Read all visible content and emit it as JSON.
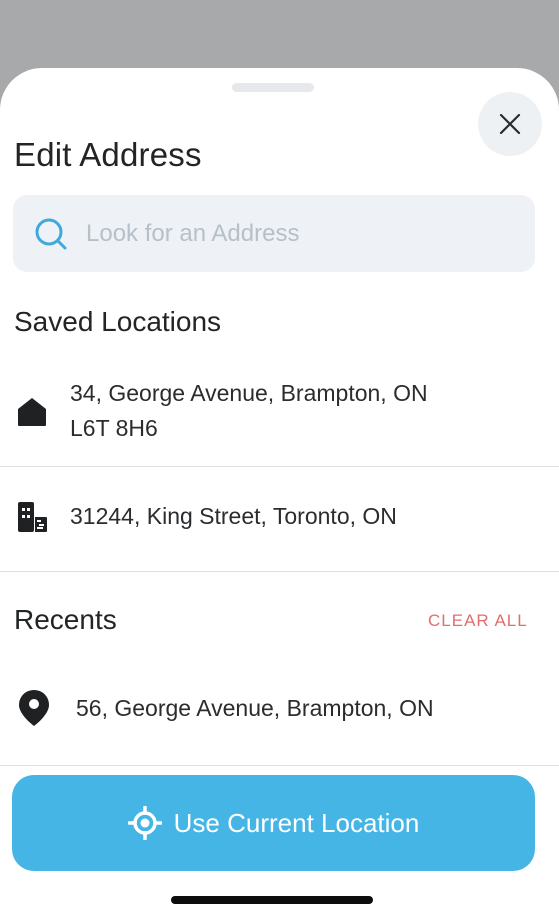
{
  "sheet": {
    "title": "Edit Address",
    "close_icon": "close-icon"
  },
  "search": {
    "placeholder": "Look for an Address",
    "icon": "search-icon"
  },
  "saved": {
    "title": "Saved Locations",
    "items": [
      {
        "icon": "home-icon",
        "address": "34, George Avenue, Brampton, ON L6T 8H6"
      },
      {
        "icon": "office-building-icon",
        "address": "31244, King Street, Toronto, ON"
      }
    ]
  },
  "recents": {
    "title": "Recents",
    "clear_all": "CLEAR ALL",
    "items": [
      {
        "icon": "map-pin-icon",
        "address": "56, George Avenue, Brampton, ON"
      }
    ]
  },
  "cta": {
    "label": "Use Current Location",
    "icon": "locate-crosshair-icon"
  },
  "colors": {
    "accent": "#45b5e6",
    "danger": "#e06e6e",
    "text": "#222426"
  }
}
